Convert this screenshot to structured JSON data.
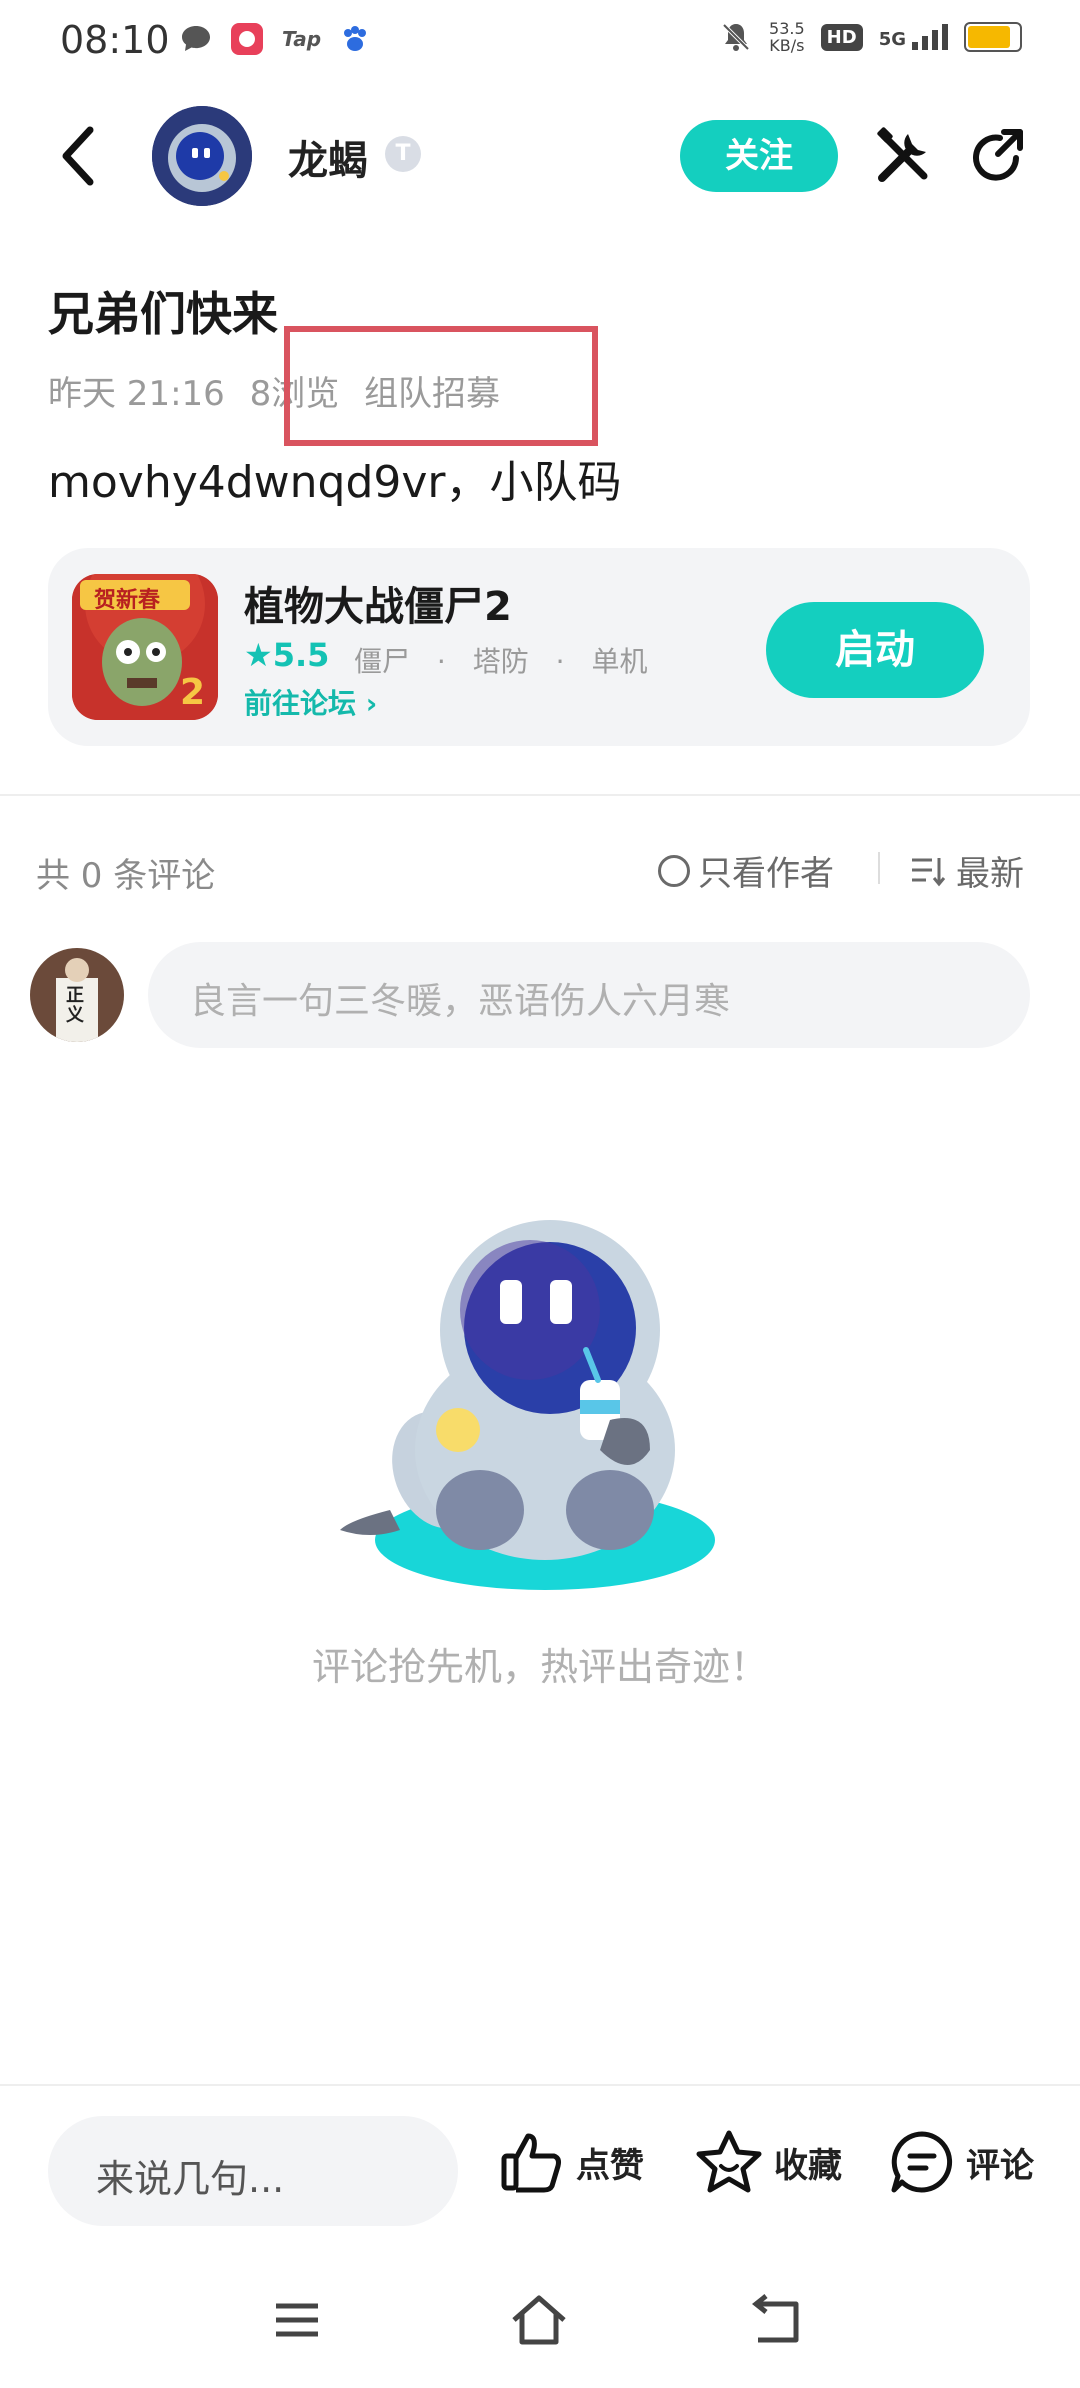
{
  "status_bar": {
    "time": "08:10",
    "net_speed_value": "53.5",
    "net_speed_unit": "KB/s",
    "hd_label": "HD",
    "network_label": "5G",
    "app_icon_tap": "Tap",
    "battery_level": 0.85,
    "battery_color": "#f6b800"
  },
  "header": {
    "author_name": "龙蝎",
    "level_badge": "T",
    "follow_label": "关注"
  },
  "post": {
    "title": "兄弟们快来",
    "time": "昨天 21:16",
    "views": "8浏览",
    "category": "组队招募",
    "body": "movhy4dwnqd9vr，小队码"
  },
  "game_card": {
    "name": "植物大战僵尸2",
    "rating": "5.5",
    "tags": [
      "僵尸",
      "塔防",
      "单机"
    ],
    "forum_link": "前往论坛",
    "launch_label": "启动",
    "icon_banner": "贺新春"
  },
  "comments": {
    "count_label": "共 0 条评论",
    "only_author_label": "只看作者",
    "sort_label": "最新",
    "input_placeholder": "良言一句三冬暖，恶语伤人六月寒",
    "empty_text": "评论抢先机，热评出奇迹！",
    "avatar_text": "正义"
  },
  "bottom_bar": {
    "input_placeholder": "来说几句...",
    "like_label": "点赞",
    "favorite_label": "收藏",
    "comment_label": "评论"
  },
  "colors": {
    "accent": "#14cfbf",
    "highlight_box": "#d9545f"
  }
}
